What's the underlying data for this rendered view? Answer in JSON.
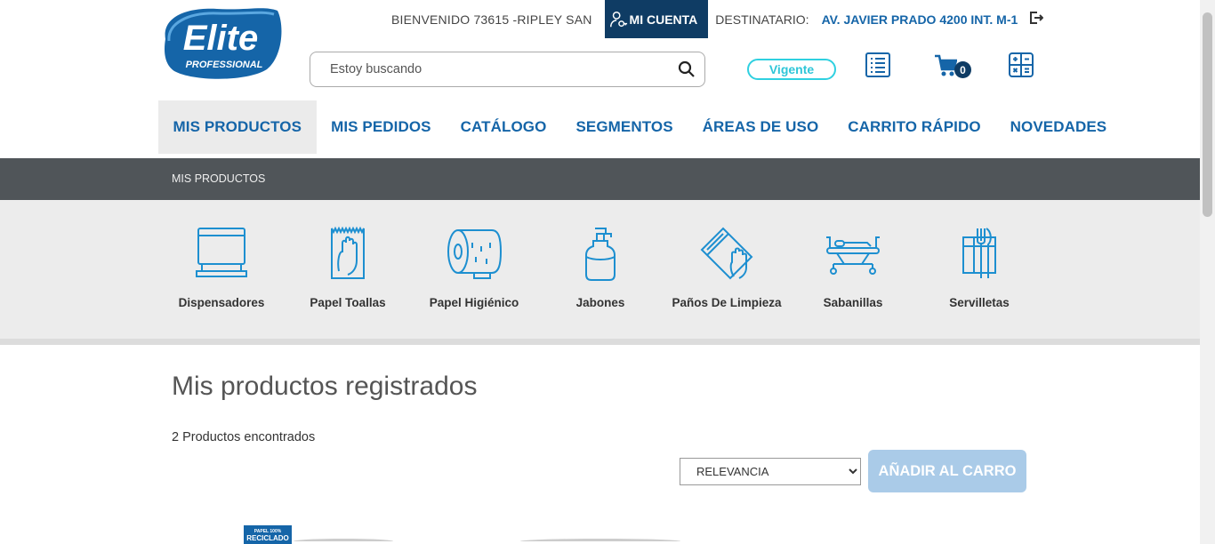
{
  "header": {
    "logo_text": "Elite",
    "logo_sub": "PROFESSIONAL",
    "welcome": "BIENVENIDO 73615 -RIPLEY SAN",
    "account_label": "MI CUENTA",
    "recipient_label": "DESTINATARIO:",
    "recipient_value": "AV. JAVIER PRADO 4200 INT. M-1",
    "search_placeholder": "Estoy buscando",
    "status": "Vigente",
    "cart_count": "0",
    "icons": [
      "user-key-icon",
      "logout-icon",
      "search-icon",
      "list-icon",
      "cart-icon",
      "calculator-icon"
    ]
  },
  "nav": {
    "items": [
      "MIS PRODUCTOS",
      "MIS PEDIDOS",
      "CATÁLOGO",
      "SEGMENTOS",
      "ÁREAS DE USO",
      "CARRITO RÁPIDO",
      "NOVEDADES"
    ],
    "active": "MIS PRODUCTOS"
  },
  "breadcrumb": "MIS PRODUCTOS",
  "categories": [
    {
      "label": "Dispensadores",
      "icon": "dispenser-icon"
    },
    {
      "label": "Papel Toallas",
      "icon": "paper-towel-icon"
    },
    {
      "label": "Papel Higiénico",
      "icon": "toilet-paper-icon"
    },
    {
      "label": "Jabones",
      "icon": "soap-icon"
    },
    {
      "label": "Paños De Limpieza",
      "icon": "cleaning-cloth-icon"
    },
    {
      "label": "Sabanillas",
      "icon": "stretcher-icon"
    },
    {
      "label": "Servilletas",
      "icon": "napkin-icon"
    }
  ],
  "main": {
    "title": "Mis productos registrados",
    "count_text": "2 Productos encontrados",
    "sort_selected": "RELEVANCIA",
    "add_button": "AÑADIR AL CARRO",
    "product_badge_top": "PAPEL 100%",
    "product_badge_bottom": "RECICLADO"
  },
  "colors": {
    "brand_blue": "#1565a8",
    "dark_navy": "#0f3c64",
    "status_cyan": "#2fd0e0",
    "breadcrumb_bg": "#505559",
    "category_bg": "#ececec",
    "disabled_button": "#aacbe8"
  }
}
